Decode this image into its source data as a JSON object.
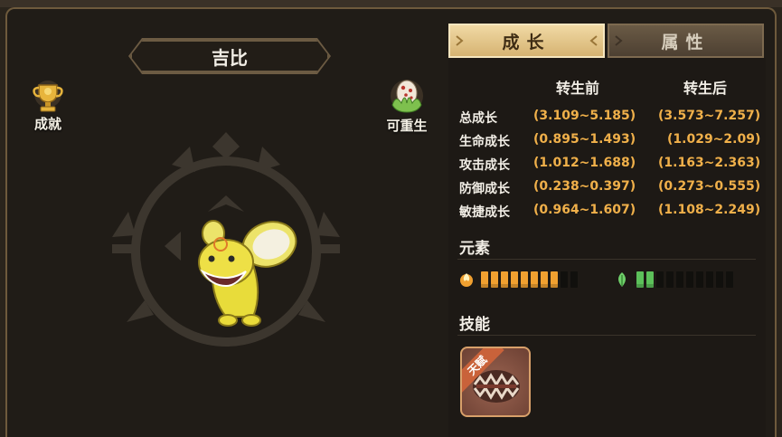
{
  "pet": {
    "name": "吉比"
  },
  "left_buttons": {
    "achievement": "成就",
    "rebirth": "可重生"
  },
  "tabs": {
    "growth": "成长",
    "attributes": "属性"
  },
  "growth_table": {
    "col_before": "转生前",
    "col_after": "转生后",
    "rows": [
      {
        "label": "总成长",
        "before": "(3.109~5.185)",
        "after": "(3.573~7.257)"
      },
      {
        "label": "生命成长",
        "before": "(0.895~1.493)",
        "after": "(1.029~2.09)"
      },
      {
        "label": "攻击成长",
        "before": "(1.012~1.688)",
        "after": "(1.163~2.363)"
      },
      {
        "label": "防御成长",
        "before": "(0.238~0.397)",
        "after": "(0.273~0.555)"
      },
      {
        "label": "敏捷成长",
        "before": "(0.964~1.607)",
        "after": "(1.108~2.249)"
      }
    ]
  },
  "elements": {
    "title": "元素",
    "items": [
      {
        "icon": "fire-element-icon",
        "filled": 8,
        "total": 10,
        "color": "#f0a030"
      },
      {
        "icon": "leaf-element-icon",
        "filled": 2,
        "total": 10,
        "color": "#5cc05a"
      }
    ]
  },
  "skills": {
    "title": "技能",
    "items": [
      {
        "tag": "天赋",
        "icon": "bite-skill-icon"
      }
    ]
  },
  "colors": {
    "value": "#f0b04a",
    "tab_active": "#e6c98a",
    "tab_inactive": "#5a4b3a"
  }
}
